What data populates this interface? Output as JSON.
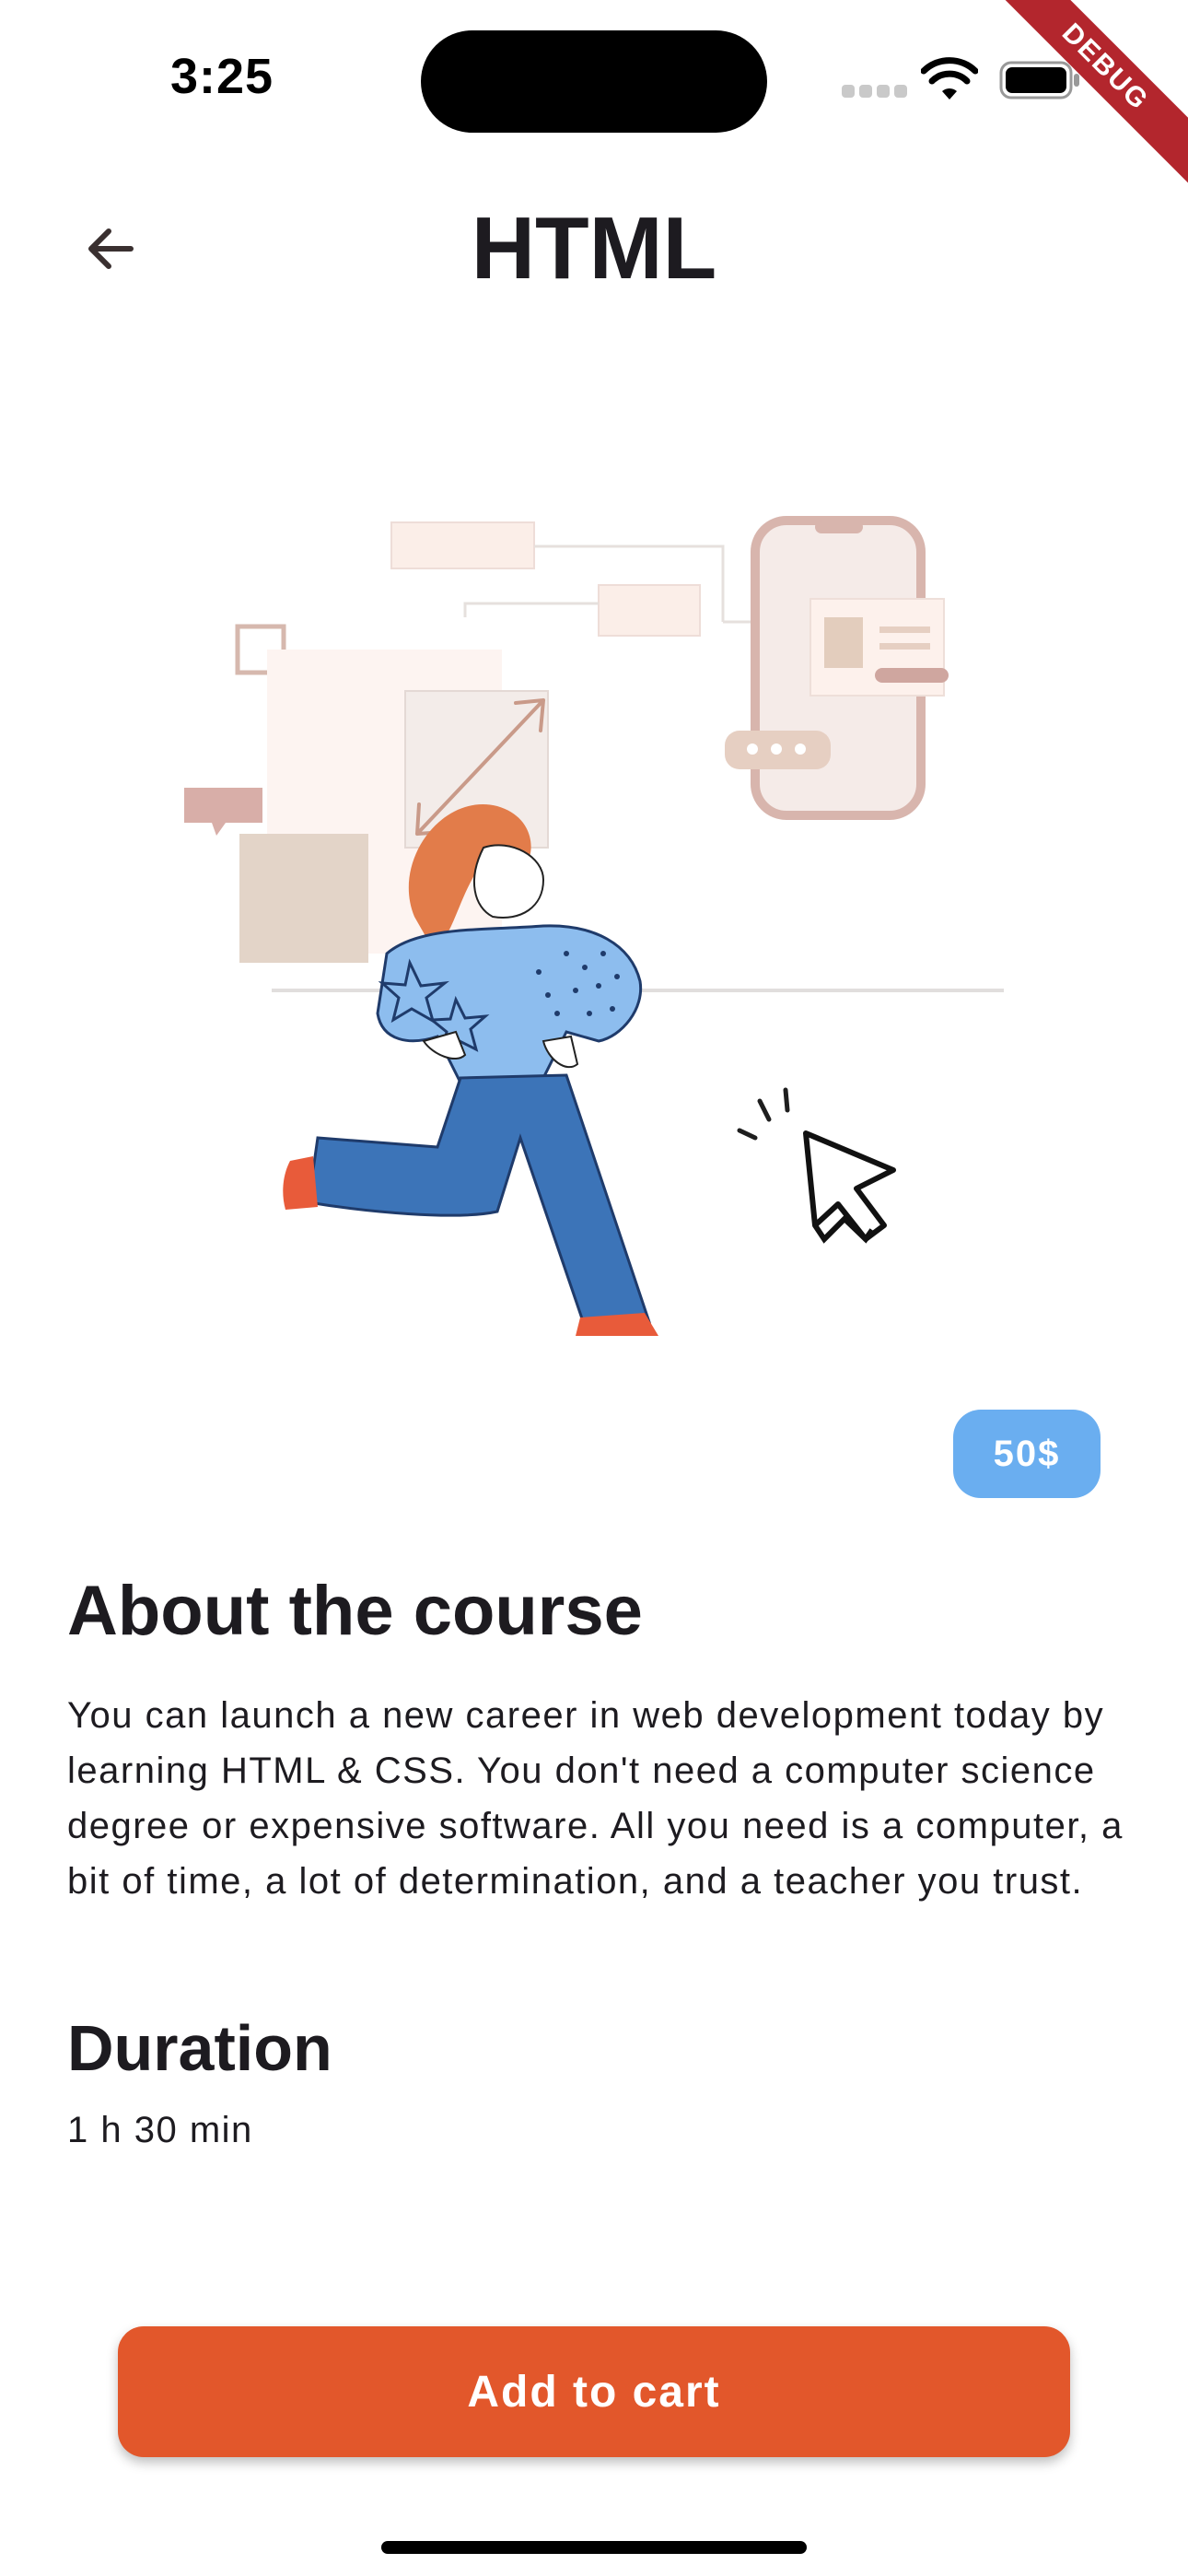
{
  "status_bar": {
    "time": "3:25",
    "debug_label": "DEBUG"
  },
  "app_bar": {
    "title": "HTML"
  },
  "course": {
    "price": "50$",
    "about_title": "About the course",
    "about_text": "You can launch a new career in web development today by learning HTML & CSS. You don't need a computer science degree or expensive software. All you need is a computer, a bit of time, a lot of determination, and a teacher you trust.",
    "duration_title": "Duration",
    "duration_value": "1 h 30 min"
  },
  "actions": {
    "add_to_cart": "Add to cart"
  },
  "colors": {
    "accent": "#e2572b",
    "badge": "#6aaef0",
    "text": "#1d1b20",
    "debug": "#b3262d"
  },
  "icons": {
    "back": "arrow-left-icon",
    "wifi": "wifi-icon",
    "battery": "battery-icon"
  }
}
